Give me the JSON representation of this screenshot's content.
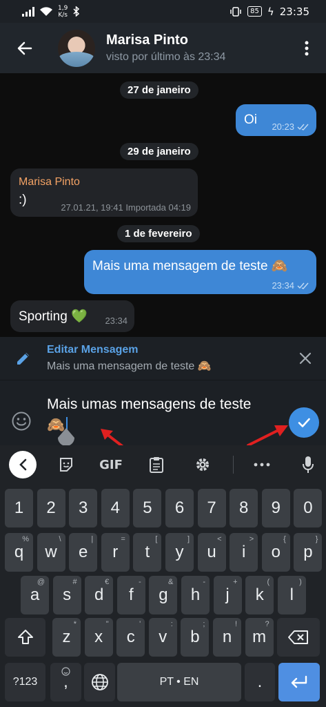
{
  "status_bar": {
    "speed_top": "1,9",
    "speed_bottom": "K/s",
    "battery": "85",
    "time": "23:35"
  },
  "header": {
    "name": "Marisa Pinto",
    "status": "visto por último às 23:34"
  },
  "chat": {
    "dates": [
      "27 de janeiro",
      "29 de janeiro",
      "1 de fevereiro"
    ],
    "messages": [
      {
        "direction": "out",
        "text": "Oi",
        "time": "20:23"
      },
      {
        "direction": "in",
        "sender": "Marisa Pinto",
        "text": ":)",
        "time": "27.01.21, 19:41 Importada 04:19"
      },
      {
        "direction": "out",
        "text": "Mais uma mensagem de teste 🙈",
        "time": "23:34"
      },
      {
        "direction": "in",
        "text": "Sporting 💚",
        "time": "23:34"
      }
    ]
  },
  "edit_bar": {
    "title": "Editar Mensagem",
    "subtitle": "Mais uma mensagem de teste 🙈"
  },
  "input": {
    "line1": "Mais umas mensagens de teste",
    "line2": "🙈"
  },
  "keyboard": {
    "toolbar_gif": "GIF",
    "number_row": [
      "1",
      "2",
      "3",
      "4",
      "5",
      "6",
      "7",
      "8",
      "9",
      "0"
    ],
    "row1": [
      {
        "k": "q",
        "h": "%"
      },
      {
        "k": "w",
        "h": "\\"
      },
      {
        "k": "e",
        "h": "|"
      },
      {
        "k": "r",
        "h": "="
      },
      {
        "k": "t",
        "h": "["
      },
      {
        "k": "y",
        "h": "]"
      },
      {
        "k": "u",
        "h": "<"
      },
      {
        "k": "i",
        "h": ">"
      },
      {
        "k": "o",
        "h": "{"
      },
      {
        "k": "p",
        "h": "}"
      }
    ],
    "row2": [
      {
        "k": "a",
        "h": "@"
      },
      {
        "k": "s",
        "h": "#"
      },
      {
        "k": "d",
        "h": "€"
      },
      {
        "k": "f",
        "h": "-"
      },
      {
        "k": "g",
        "h": "&"
      },
      {
        "k": "h",
        "h": "-"
      },
      {
        "k": "j",
        "h": "+"
      },
      {
        "k": "k",
        "h": "("
      },
      {
        "k": "l",
        "h": ")"
      }
    ],
    "row3": [
      {
        "k": "z",
        "h": "*"
      },
      {
        "k": "x",
        "h": "\""
      },
      {
        "k": "c",
        "h": "'"
      },
      {
        "k": "v",
        "h": ":"
      },
      {
        "k": "b",
        "h": ";"
      },
      {
        "k": "n",
        "h": "!"
      },
      {
        "k": "m",
        "h": "?"
      }
    ],
    "symbols_key": "?123",
    "comma_key": ",",
    "space_label": "PT • EN",
    "period_key": "."
  },
  "colors": {
    "accent": "#3e8fe3",
    "outgoing_bubble": "#3e87d6",
    "incoming_bubble": "#222428",
    "sender_name": "#f4a365",
    "annotation_arrow": "#e02020"
  },
  "icons": [
    "back-arrow-icon",
    "more-vert-icon",
    "pencil-icon",
    "close-icon",
    "emoji-icon",
    "check-icon",
    "chevron-left-icon",
    "sticker-icon",
    "clipboard-icon",
    "gear-icon",
    "more-horiz-icon",
    "mic-icon",
    "shift-icon",
    "backspace-icon",
    "globe-icon",
    "enter-icon"
  ]
}
